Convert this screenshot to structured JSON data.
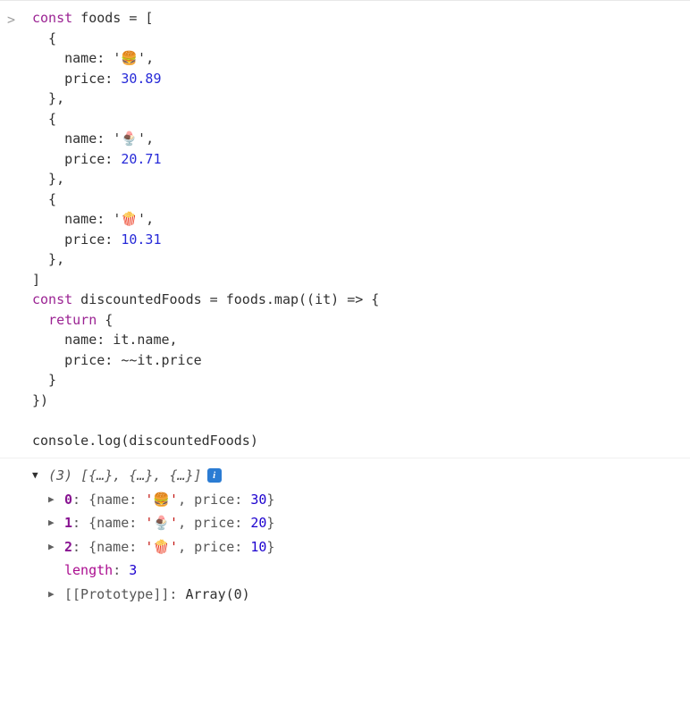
{
  "input": {
    "prompt": ">",
    "lines": [
      {
        "segments": [
          {
            "t": "const",
            "c": "keyword"
          },
          {
            "t": " foods = [",
            "c": ""
          }
        ]
      },
      {
        "segments": [
          {
            "t": "  {",
            "c": ""
          }
        ]
      },
      {
        "segments": [
          {
            "t": "    name: ",
            "c": ""
          },
          {
            "t": "'🍔'",
            "c": "string"
          },
          {
            "t": ",",
            "c": ""
          }
        ]
      },
      {
        "segments": [
          {
            "t": "    price: ",
            "c": ""
          },
          {
            "t": "30.89",
            "c": "number"
          }
        ]
      },
      {
        "segments": [
          {
            "t": "  },",
            "c": ""
          }
        ]
      },
      {
        "segments": [
          {
            "t": "  {",
            "c": ""
          }
        ]
      },
      {
        "segments": [
          {
            "t": "    name: ",
            "c": ""
          },
          {
            "t": "'🍨'",
            "c": "string"
          },
          {
            "t": ",",
            "c": ""
          }
        ]
      },
      {
        "segments": [
          {
            "t": "    price: ",
            "c": ""
          },
          {
            "t": "20.71",
            "c": "number"
          }
        ]
      },
      {
        "segments": [
          {
            "t": "  },",
            "c": ""
          }
        ]
      },
      {
        "segments": [
          {
            "t": "  {",
            "c": ""
          }
        ]
      },
      {
        "segments": [
          {
            "t": "    name: ",
            "c": ""
          },
          {
            "t": "'🍿'",
            "c": "string"
          },
          {
            "t": ",",
            "c": ""
          }
        ]
      },
      {
        "segments": [
          {
            "t": "    price: ",
            "c": ""
          },
          {
            "t": "10.31",
            "c": "number"
          }
        ]
      },
      {
        "segments": [
          {
            "t": "  },",
            "c": ""
          }
        ]
      },
      {
        "segments": [
          {
            "t": "]",
            "c": ""
          }
        ]
      },
      {
        "segments": [
          {
            "t": "const",
            "c": "keyword"
          },
          {
            "t": " discountedFoods = foods.map((it) => {",
            "c": ""
          }
        ]
      },
      {
        "segments": [
          {
            "t": "  ",
            "c": ""
          },
          {
            "t": "return",
            "c": "keyword"
          },
          {
            "t": " {",
            "c": ""
          }
        ]
      },
      {
        "segments": [
          {
            "t": "    name: it.name,",
            "c": ""
          }
        ]
      },
      {
        "segments": [
          {
            "t": "    price: ~~it.price",
            "c": ""
          }
        ]
      },
      {
        "segments": [
          {
            "t": "  }",
            "c": ""
          }
        ]
      },
      {
        "segments": [
          {
            "t": "})",
            "c": ""
          }
        ]
      },
      {
        "segments": [
          {
            "t": "",
            "c": ""
          }
        ]
      },
      {
        "segments": [
          {
            "t": "console.log(discountedFoods)",
            "c": ""
          }
        ]
      }
    ]
  },
  "output": {
    "summary": {
      "count": "(3)",
      "preview": "[{…}, {…}, {…}]"
    },
    "items": [
      {
        "index": "0",
        "name": "'🍔'",
        "price": "30"
      },
      {
        "index": "1",
        "name": "'🍨'",
        "price": "20"
      },
      {
        "index": "2",
        "name": "'🍿'",
        "price": "10"
      }
    ],
    "length_label": "length",
    "length_value": "3",
    "proto_label": "[[Prototype]]",
    "proto_value": "Array(0)",
    "name_key": "name",
    "price_key": "price"
  }
}
